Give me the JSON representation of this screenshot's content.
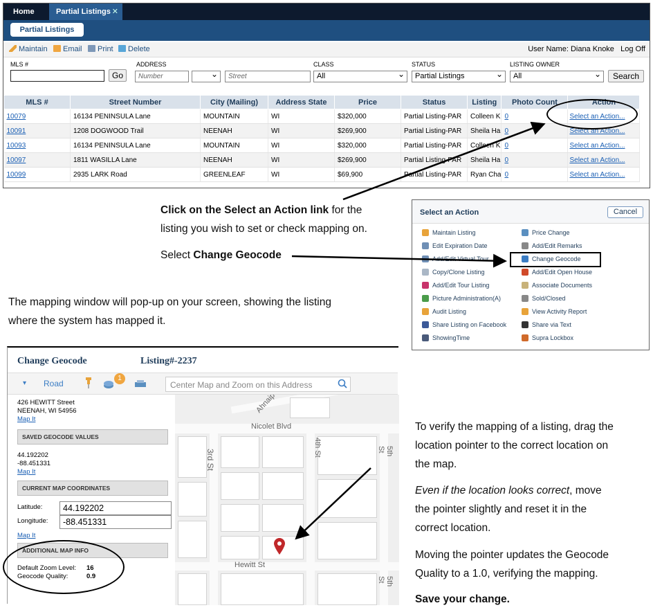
{
  "app": {
    "tabs": [
      "Home",
      "Partial Listings"
    ],
    "tab_close": "✕",
    "sub_button": "Partial Listings",
    "toolbar": {
      "maintain": "Maintain",
      "email": "Email",
      "print": "Print",
      "delete": "Delete"
    },
    "user_info": "User Name: Diana Knoke",
    "logoff": "Log Off",
    "search": {
      "mls_label": "MLS #",
      "address_label": "ADDRESS",
      "class_label": "CLASS",
      "status_label": "STATUS",
      "owner_label": "LISTING OWNER",
      "go": "Go",
      "number_placeholder": "Number",
      "street_placeholder": "Street",
      "class_value": "All",
      "status_value": "Partial Listings",
      "owner_value": "All",
      "search_button": "Search"
    },
    "table": {
      "headers": [
        "MLS #",
        "Street Number",
        "City (Mailing)",
        "Address State",
        "Price",
        "Status",
        "Listing",
        "Photo Count",
        "Action"
      ],
      "rows": [
        {
          "mls": "10079",
          "street": "16134 PENINSULA Lane",
          "city": "MOUNTAIN",
          "state": "WI",
          "price": "$320,000",
          "status": "Partial Listing-PAR",
          "listing": "Colleen K",
          "photos": "0",
          "action": "Select an Action..."
        },
        {
          "mls": "10091",
          "street": "1208 DOGWOOD Trail",
          "city": "NEENAH",
          "state": "WI",
          "price": "$269,900",
          "status": "Partial Listing-PAR",
          "listing": "Sheila Ha",
          "photos": "0",
          "action": "Select an Action..."
        },
        {
          "mls": "10093",
          "street": "16134 PENINSULA Lane",
          "city": "MOUNTAIN",
          "state": "WI",
          "price": "$320,000",
          "status": "Partial Listing-PAR",
          "listing": "Colleen K",
          "photos": "0",
          "action": "Select an Action..."
        },
        {
          "mls": "10097",
          "street": "1811 WASILLA Lane",
          "city": "NEENAH",
          "state": "WI",
          "price": "$269,900",
          "status": "Partial Listing-PAR",
          "listing": "Sheila Ha",
          "photos": "0",
          "action": "Select an Action..."
        },
        {
          "mls": "10099",
          "street": "2935 LARK Road",
          "city": "GREENLEAF",
          "state": "WI",
          "price": "$69,900",
          "status": "Partial Listing-PAR",
          "listing": "Ryan Cha",
          "photos": "0",
          "action": "Select an Action..."
        }
      ]
    }
  },
  "instructions": {
    "p1_bold": "Click on the Select an Action link",
    "p1_rest": " for the",
    "p1_line2": "listing you wish to set or check mapping on.",
    "p2_pre": "Select ",
    "p2_bold": "Change Geocode",
    "p3_line1": "The mapping window will pop-up on your screen, showing the listing",
    "p3_line2": "where the system has mapped it.",
    "r1_line1": "To verify the mapping of a listing, drag the",
    "r1_line2": "location pointer to the correct location on",
    "r1_line3": "the map.",
    "r2_italic": "Even if the location looks correct",
    "r2_rest": ", move",
    "r2_line2": "the pointer slightly and reset it in the",
    "r2_line3": "correct location.",
    "r3_line1": "Moving the pointer updates the Geocode",
    "r3_line2": "Quality to a 1.0, verifying the mapping.",
    "r4": "Save your change."
  },
  "select_action": {
    "title": "Select an Action",
    "cancel": "Cancel",
    "left": [
      {
        "label": "Maintain Listing",
        "icon": "pencil-icon",
        "color": "#e8a33a"
      },
      {
        "label": "Edit Expiration Date",
        "icon": "calendar-icon",
        "color": "#6f8fb5"
      },
      {
        "label": "Add/Edit Virtual Tour",
        "icon": "video-icon",
        "color": "#6f8fb5"
      },
      {
        "label": "Copy/Clone Listing",
        "icon": "copy-icon",
        "color": "#aab7c6"
      },
      {
        "label": "Add/Edit Tour Listing",
        "icon": "tour-icon",
        "color": "#c8336b"
      },
      {
        "label": "Picture Administration(A)",
        "icon": "picture-icon",
        "color": "#4a9c4a"
      },
      {
        "label": "Audit Listing",
        "icon": "audit-icon",
        "color": "#e8a33a"
      },
      {
        "label": "Share Listing on Facebook",
        "icon": "facebook-icon",
        "color": "#3b5998"
      },
      {
        "label": "ShowingTime",
        "icon": "showingtime-icon",
        "color": "#4a5a7a"
      }
    ],
    "right": [
      {
        "label": "Price Change",
        "icon": "price-icon",
        "color": "#5a8fc0"
      },
      {
        "label": "Add/Edit Remarks",
        "icon": "remarks-icon",
        "color": "#888888"
      },
      {
        "label": "Change Geocode",
        "icon": "globe-icon",
        "color": "#3b7dc4"
      },
      {
        "label": "Add/Edit Open House",
        "icon": "open-house-icon",
        "color": "#d04a2a"
      },
      {
        "label": "Associate Documents",
        "icon": "document-icon",
        "color": "#c8b27a"
      },
      {
        "label": "Sold/Closed",
        "icon": "sold-icon",
        "color": "#888888"
      },
      {
        "label": "View Activity Report",
        "icon": "chart-icon",
        "color": "#e8a33a"
      },
      {
        "label": "Share via Text",
        "icon": "phone-icon",
        "color": "#333333"
      },
      {
        "label": "Supra Lockbox",
        "icon": "lockbox-icon",
        "color": "#d06a2a"
      }
    ]
  },
  "geocode": {
    "title": "Change Geocode",
    "listing": "Listing#-2237",
    "road": "Road",
    "badge": "1",
    "search_placeholder": "Center Map and Zoom on this Address",
    "address_line1": "426 HEWITT Street",
    "address_line2": "NEENAH, WI 54956",
    "map_it": "Map It",
    "saved_header": "SAVED GEOCODE VALUES",
    "saved_lat": "44.192202",
    "saved_lng": "-88.451331",
    "current_header": "CURRENT MAP COORDINATES",
    "lat_label": "Latitude:",
    "lng_label": "Longitude:",
    "lat_value": "44.192202",
    "lng_value": "-88.451331",
    "additional_header": "ADDITIONAL MAP INFO",
    "zoom_label": "Default Zoom Level:",
    "zoom_value": "16",
    "quality_label": "Geocode Quality:",
    "quality_value": "0.9",
    "streets": {
      "ahnaip": "Ahnaip",
      "nicolet": "Nicolet Blvd",
      "third": "3rd St",
      "fourth": "4th St",
      "fifth": "5th St",
      "hewitt": "Hewitt St",
      "fifth_b": "5th St"
    }
  }
}
